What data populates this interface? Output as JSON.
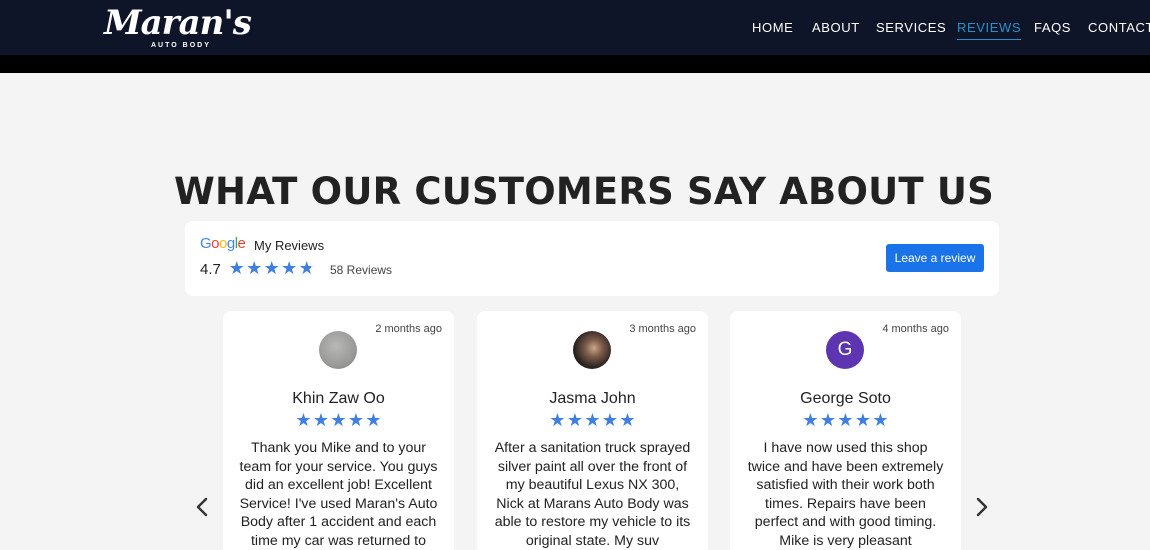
{
  "brand": {
    "script": "Maran's",
    "subtitle": "AUTO BODY"
  },
  "nav": {
    "items": [
      {
        "label": "HOME",
        "active": false
      },
      {
        "label": "ABOUT",
        "active": false
      },
      {
        "label": "SERVICES",
        "active": false
      },
      {
        "label": "REVIEWS",
        "active": true
      },
      {
        "label": "FAQS",
        "active": false
      },
      {
        "label": "CONTACT",
        "active": false
      }
    ]
  },
  "section": {
    "title": "WHAT OUR CUSTOMERS SAY ABOUT US"
  },
  "summary": {
    "google_letters": [
      "G",
      "o",
      "o",
      "g",
      "l",
      "e"
    ],
    "google_colors": [
      "#4285F4",
      "#EA4335",
      "#FBBC05",
      "#4285F4",
      "#34A853",
      "#EA4335"
    ],
    "title": "My Reviews",
    "rating": "4.7",
    "rating_value": 4.7,
    "review_count": "58 Reviews",
    "button": "Leave a review"
  },
  "star_color": "#3f7fe0",
  "reviews": [
    {
      "time": "2 months ago",
      "avatar": "photo-gray",
      "name": "Khin Zaw Oo",
      "stars": 5,
      "text": "Thank you Mike and to your team for your service. You guys did an excellent job! Excellent Service! I've used Maran's Auto Body after 1 accident and each time my car was returned to"
    },
    {
      "time": "3 months ago",
      "avatar": "photo-person",
      "name": "Jasma John",
      "stars": 5,
      "text": "After a sanitation truck sprayed silver paint all over the front of my beautiful Lexus NX 300, Nick at Marans Auto Body was able to restore my vehicle to its original state. My suv"
    },
    {
      "time": "4 months ago",
      "avatar": "letter",
      "avatar_letter": "G",
      "name": "George Soto",
      "stars": 5,
      "text": "I have now used this shop twice and have been extremely satisfied with their work both times. Repairs have been perfect and with good timing. Mike is very pleasant"
    }
  ],
  "carousel": {
    "prev_icon": "chevron-left-icon",
    "next_icon": "chevron-right-icon"
  }
}
